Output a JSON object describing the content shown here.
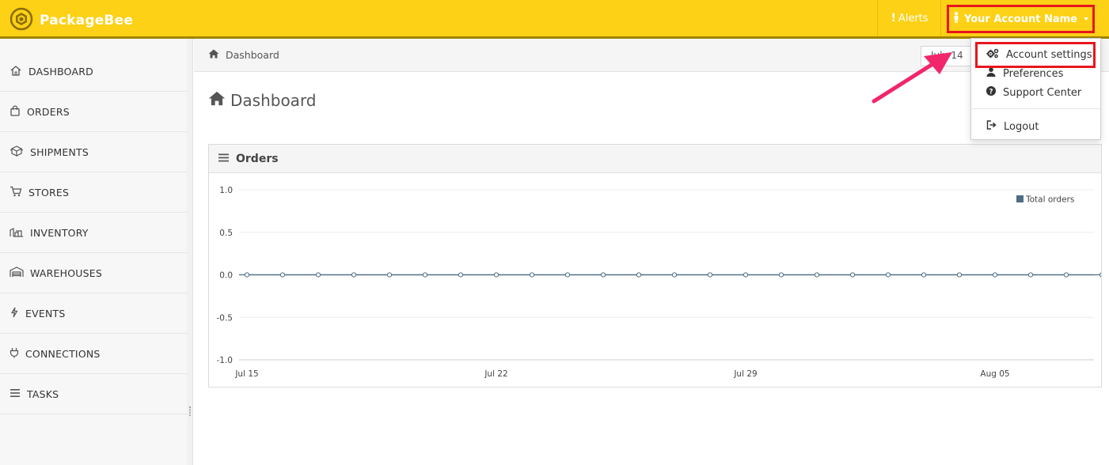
{
  "brand": {
    "name": "PackageBee"
  },
  "topnav": {
    "alerts_label": "Alerts",
    "account_label": "Your Account Name"
  },
  "sidebar": {
    "items": [
      {
        "label": "DASHBOARD",
        "icon": "home-icon"
      },
      {
        "label": "ORDERS",
        "icon": "shopping-bag-icon"
      },
      {
        "label": "SHIPMENTS",
        "icon": "boxes-icon"
      },
      {
        "label": "STORES",
        "icon": "cart-icon"
      },
      {
        "label": "INVENTORY",
        "icon": "inventory-icon"
      },
      {
        "label": "WAREHOUSES",
        "icon": "warehouse-icon"
      },
      {
        "label": "EVENTS",
        "icon": "lightning-icon"
      },
      {
        "label": "CONNECTIONS",
        "icon": "plug-icon"
      },
      {
        "label": "TASKS",
        "icon": "bars-icon"
      }
    ]
  },
  "breadcrumb": {
    "label": "Dashboard"
  },
  "daterange": {
    "value": "July 14"
  },
  "page": {
    "title": "Dashboard"
  },
  "widget": {
    "title": "Orders"
  },
  "dropdown": {
    "items": [
      {
        "label": "Account settings",
        "icon": "gears-icon"
      },
      {
        "label": "Preferences",
        "icon": "user-icon"
      },
      {
        "label": "Support Center",
        "icon": "question-icon"
      },
      {
        "label": "Logout",
        "icon": "sign-out-icon"
      }
    ]
  },
  "colors": {
    "topbar": "#fcd116",
    "highlight": "#e8161d",
    "arrow": "#f2266a",
    "series": "#4f6d86"
  },
  "chart_data": {
    "type": "line",
    "title": "",
    "xlabel": "",
    "ylabel": "",
    "ylim": [
      -1.0,
      1.0
    ],
    "yticks": [
      "1.0",
      "0.5",
      "0.0",
      "-0.5",
      "-1.0"
    ],
    "xtick_labels": [
      "Jul 15",
      "Jul 22",
      "Jul 29",
      "Aug 05"
    ],
    "legend_position": "top-right",
    "grid": true,
    "x": [
      "2016-07-15",
      "2016-07-16",
      "2016-07-17",
      "2016-07-18",
      "2016-07-19",
      "2016-07-20",
      "2016-07-21",
      "2016-07-22",
      "2016-07-23",
      "2016-07-24",
      "2016-07-25",
      "2016-07-26",
      "2016-07-27",
      "2016-07-28",
      "2016-07-29",
      "2016-07-30",
      "2016-07-31",
      "2016-08-01",
      "2016-08-02",
      "2016-08-03",
      "2016-08-04",
      "2016-08-05",
      "2016-08-06",
      "2016-08-07",
      "2016-08-08"
    ],
    "series": [
      {
        "name": "Total orders",
        "values": [
          0,
          0,
          0,
          0,
          0,
          0,
          0,
          0,
          0,
          0,
          0,
          0,
          0,
          0,
          0,
          0,
          0,
          0,
          0,
          0,
          0,
          0,
          0,
          0,
          0
        ]
      }
    ]
  }
}
